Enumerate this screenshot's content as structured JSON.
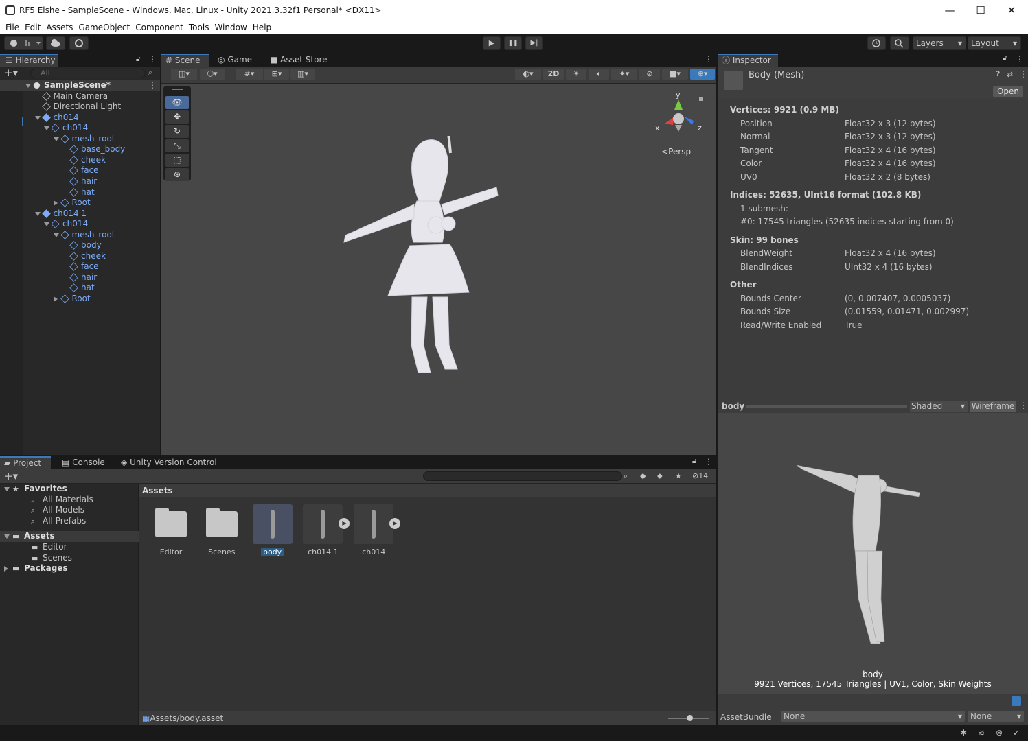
{
  "window": {
    "title": "RF5 Elshe - SampleScene - Windows, Mac, Linux - Unity 2021.3.32f1 Personal* <DX11>",
    "minimize": "—",
    "maximize": "☐",
    "close": "✕"
  },
  "menu": [
    "File",
    "Edit",
    "Assets",
    "GameObject",
    "Component",
    "Tools",
    "Window",
    "Help"
  ],
  "toolbar": {
    "layers": "Layers",
    "layout": "Layout",
    "play": "▶",
    "pause": "❚❚",
    "step": "▶|"
  },
  "hierarchy": {
    "tab": "Hierarchy",
    "search_placeholder": "All",
    "rows": [
      {
        "label": "SampleScene*",
        "indent": 0,
        "expander": "down",
        "icon": "unity-scene",
        "color": "white",
        "bold": true
      },
      {
        "label": "Main Camera",
        "indent": 1,
        "expander": "",
        "icon": "cube",
        "color": "white"
      },
      {
        "label": "Directional Light",
        "indent": 1,
        "expander": "",
        "icon": "cube",
        "color": "white"
      },
      {
        "label": "ch014",
        "indent": 1,
        "expander": "down",
        "icon": "prefab",
        "color": "blue"
      },
      {
        "label": "ch014",
        "indent": 2,
        "expander": "down",
        "icon": "cube",
        "color": "blue"
      },
      {
        "label": "mesh_root",
        "indent": 3,
        "expander": "down",
        "icon": "cube",
        "color": "blue"
      },
      {
        "label": "base_body",
        "indent": 4,
        "expander": "",
        "icon": "cube",
        "color": "blue"
      },
      {
        "label": "cheek",
        "indent": 4,
        "expander": "",
        "icon": "cube",
        "color": "blue"
      },
      {
        "label": "face",
        "indent": 4,
        "expander": "",
        "icon": "cube",
        "color": "blue"
      },
      {
        "label": "hair",
        "indent": 4,
        "expander": "",
        "icon": "cube",
        "color": "blue"
      },
      {
        "label": "hat",
        "indent": 4,
        "expander": "",
        "icon": "cube",
        "color": "blue"
      },
      {
        "label": "Root",
        "indent": 3,
        "expander": "right",
        "icon": "cube",
        "color": "blue"
      },
      {
        "label": "ch014 1",
        "indent": 1,
        "expander": "down",
        "icon": "prefab",
        "color": "blue"
      },
      {
        "label": "ch014",
        "indent": 2,
        "expander": "down",
        "icon": "cube",
        "color": "blue"
      },
      {
        "label": "mesh_root",
        "indent": 3,
        "expander": "down",
        "icon": "cube",
        "color": "blue"
      },
      {
        "label": "body",
        "indent": 4,
        "expander": "",
        "icon": "cube",
        "color": "blue"
      },
      {
        "label": "cheek",
        "indent": 4,
        "expander": "",
        "icon": "cube",
        "color": "blue"
      },
      {
        "label": "face",
        "indent": 4,
        "expander": "",
        "icon": "cube",
        "color": "blue"
      },
      {
        "label": "hair",
        "indent": 4,
        "expander": "",
        "icon": "cube",
        "color": "blue"
      },
      {
        "label": "hat",
        "indent": 4,
        "expander": "",
        "icon": "cube",
        "color": "blue"
      },
      {
        "label": "Root",
        "indent": 3,
        "expander": "right",
        "icon": "cube",
        "color": "blue"
      }
    ]
  },
  "scene": {
    "tabs": [
      "Scene",
      "Game",
      "Asset Store"
    ],
    "btn_2d": "2D",
    "persp": "Persp",
    "axis_x": "x",
    "axis_y": "y",
    "axis_z": "z"
  },
  "inspector": {
    "tab": "Inspector",
    "object": "Body (Mesh)",
    "open": "Open",
    "sections": [
      {
        "header": "Vertices: 9921 (0.9 MB)",
        "rows": [
          [
            "Position",
            "Float32 x 3 (12 bytes)"
          ],
          [
            "Normal",
            "Float32 x 3 (12 bytes)"
          ],
          [
            "Tangent",
            "Float32 x 4 (16 bytes)"
          ],
          [
            "Color",
            "Float32 x 4 (16 bytes)"
          ],
          [
            "UV0",
            "Float32 x 2 (8 bytes)"
          ]
        ]
      },
      {
        "header": "Indices: 52635, UInt16 format (102.8 KB)",
        "rows": [
          [
            "1 submesh:",
            ""
          ],
          [
            "#0: 17545 triangles (52635 indices starting from 0)",
            ""
          ]
        ]
      },
      {
        "header": "Skin: 99 bones",
        "rows": [
          [
            "BlendWeight",
            "Float32 x 4 (16 bytes)"
          ],
          [
            "BlendIndices",
            "UInt32 x 4 (16 bytes)"
          ]
        ]
      },
      {
        "header": "Other",
        "rows": [
          [
            "Bounds Center",
            "(0, 0.007407, 0.0005037)"
          ],
          [
            "Bounds Size",
            "(0.01559, 0.01471, 0.002997)"
          ],
          [
            "Read/Write Enabled",
            "True"
          ]
        ]
      }
    ],
    "preview": {
      "name": "body",
      "shading": "Shaded",
      "wireframe": "Wireframe",
      "caption_name": "body",
      "caption_stats": "9921 Vertices, 17545 Triangles | UV1, Color, Skin Weights"
    },
    "assetbundle": {
      "label": "AssetBundle",
      "value": "None",
      "variant": "None"
    }
  },
  "project": {
    "tabs": [
      "Project",
      "Console",
      "Unity Version Control"
    ],
    "hidden_count": "14",
    "tree": [
      {
        "label": "Favorites",
        "indent": 0,
        "expander": "down",
        "bold": true,
        "icon": "star"
      },
      {
        "label": "All Materials",
        "indent": 1,
        "expander": "",
        "icon": "search"
      },
      {
        "label": "All Models",
        "indent": 1,
        "expander": "",
        "icon": "search"
      },
      {
        "label": "All Prefabs",
        "indent": 1,
        "expander": "",
        "icon": "search"
      },
      {
        "label": "Assets",
        "indent": 0,
        "expander": "down",
        "bold": true,
        "icon": "folder",
        "selected": true
      },
      {
        "label": "Editor",
        "indent": 1,
        "expander": "",
        "icon": "folder"
      },
      {
        "label": "Scenes",
        "indent": 1,
        "expander": "",
        "icon": "folder"
      },
      {
        "label": "Packages",
        "indent": 0,
        "expander": "right",
        "bold": true,
        "icon": "folder"
      }
    ],
    "breadcrumb": "Assets",
    "assets": [
      {
        "label": "Editor",
        "type": "folder"
      },
      {
        "label": "Scenes",
        "type": "folder"
      },
      {
        "label": "body",
        "type": "mesh",
        "selected": true
      },
      {
        "label": "ch014 1",
        "type": "model"
      },
      {
        "label": "ch014",
        "type": "model"
      }
    ],
    "status_path": "Assets/body.asset"
  }
}
